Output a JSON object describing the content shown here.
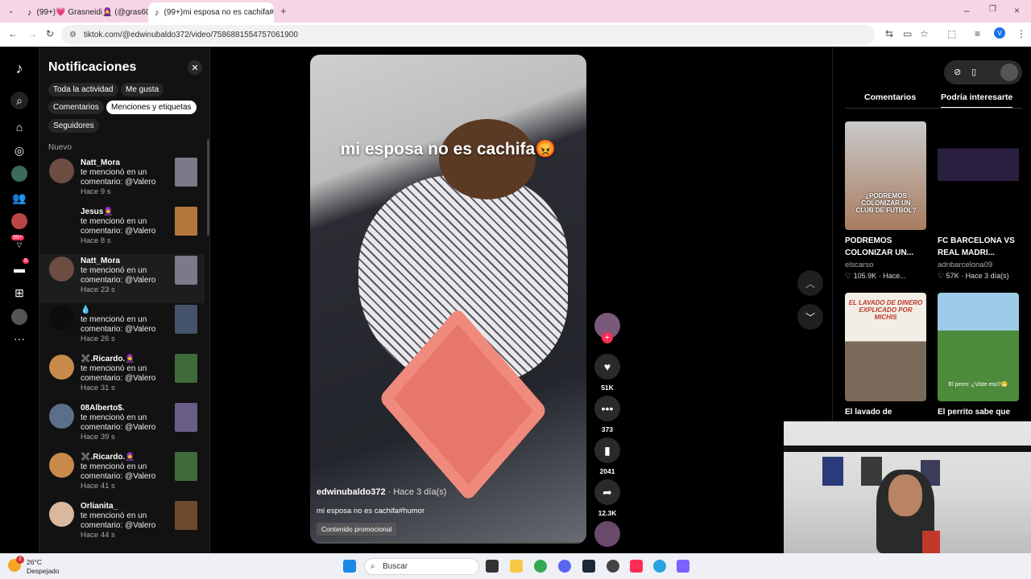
{
  "browser": {
    "tabs": [
      {
        "title": "(99+)💗 Grasneidi🧕 (@gras60",
        "active": false
      },
      {
        "title": "(99+)mi esposa no es cachifa#h",
        "active": true
      }
    ],
    "url": "tiktok.com/@edwinubaldo372/video/7586881554757061900"
  },
  "notifications": {
    "title": "Notificaciones",
    "filters": [
      "Toda la actividad",
      "Me gusta",
      "Comentarios",
      "Menciones y etiquetas",
      "Seguidores"
    ],
    "active_filter": "Menciones y etiquetas",
    "section": "Nuevo",
    "items": [
      {
        "name": "Natt_Mora",
        "text": "te mencionó en un comentario: @Valero",
        "time": "Hace 9 s"
      },
      {
        "name": "Jesus🧕",
        "text": "te mencionó en un comentario: @Valero",
        "time": "Hace 8 s"
      },
      {
        "name": "Natt_Mora",
        "text": "te mencionó en un comentario: @Valero",
        "time": "Hace 23 s"
      },
      {
        "name": "💧",
        "text": "te mencionó en un comentario: @Valero",
        "time": "Hace 26 s"
      },
      {
        "name": "✖️.Ricardo.🧕",
        "text": "te mencionó en un comentario: @Valero",
        "time": "Hace 31 s"
      },
      {
        "name": "08Alberto$.",
        "text": "te mencionó en un comentario: @Valero",
        "time": "Hace 39 s"
      },
      {
        "name": "✖️.Ricardo.🧕",
        "text": "te mencionó en un comentario: @Valero",
        "time": "Hace 41 s"
      },
      {
        "name": "Orlianita_",
        "text": "te mencionó en un comentario: @Valero",
        "time": "Hace 44 s"
      }
    ]
  },
  "video": {
    "overlay_title": "mi esposa no es cachifa😡",
    "author": "edwinubaldo372",
    "posted": "· Hace 3 día(s)",
    "description": "mi esposa no es cachifa#humor",
    "promo": "Contenido promocional",
    "likes": "51K",
    "comments": "373",
    "saves": "2041",
    "shares": "12.3K"
  },
  "right_panel": {
    "tabs": [
      "Comentarios",
      "Podría interesarte"
    ],
    "active_tab": "Podría interesarte",
    "cards": [
      {
        "title": "PODREMOS COLONIZAR UN...",
        "author": "elscarso",
        "likes": "105.9K",
        "time": "Hace...",
        "caption": "¿PODREMOS COLONIZAR UN CLUB DE FUTBOL?"
      },
      {
        "title": "FC BARCELONA VS REAL MADRI...",
        "author": "adnbarcelona09",
        "likes": "57K",
        "time": "Hace 3 día(s)",
        "caption": ""
      },
      {
        "title": "El lavado de",
        "author": "",
        "likes": "",
        "time": "",
        "caption": "EL LAVADO DE DINERO EXPLICADO POR MICHIS"
      },
      {
        "title": "El perrito sabe que",
        "author": "",
        "likes": "",
        "time": "",
        "caption": "El perro: ¿Viste eso?😁"
      }
    ]
  },
  "taskbar": {
    "temperature": "26°C",
    "weather": "Despejado",
    "search": "Buscar",
    "badge": "2"
  },
  "rail": {
    "badge1": "99+",
    "badge2": "6"
  }
}
